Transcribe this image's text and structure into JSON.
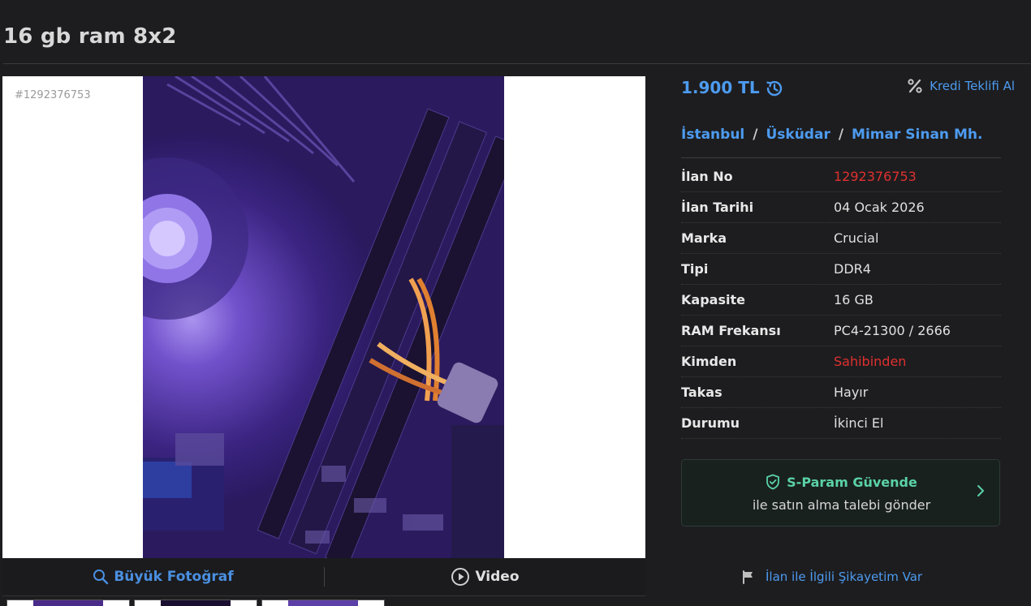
{
  "listing": {
    "title": "16 gb ram 8x2",
    "photo_id": "#1292376753"
  },
  "gallery": {
    "big_photo_label": "Büyük Fotoğraf",
    "video_label": "Video"
  },
  "price": {
    "value": "1.900 TL",
    "credit_label": "Kredi Teklifi Al"
  },
  "location": {
    "city": "İstanbul",
    "district": "Üsküdar",
    "neighborhood": "Mimar Sinan Mh.",
    "separator": "/"
  },
  "details": [
    {
      "label": "İlan No",
      "value": "1292376753",
      "highlight": true
    },
    {
      "label": "İlan Tarihi",
      "value": "04 Ocak 2026",
      "highlight": false
    },
    {
      "label": "Marka",
      "value": "Crucial",
      "highlight": false
    },
    {
      "label": "Tipi",
      "value": "DDR4",
      "highlight": false
    },
    {
      "label": "Kapasite",
      "value": "16 GB",
      "highlight": false
    },
    {
      "label": "RAM Frekansı",
      "value": "PC4-21300 / 2666",
      "highlight": false
    },
    {
      "label": "Kimden",
      "value": "Sahibinden",
      "highlight": true
    },
    {
      "label": "Takas",
      "value": "Hayır",
      "highlight": false
    },
    {
      "label": "Durumu",
      "value": "İkinci El",
      "highlight": false
    }
  ],
  "sparam": {
    "title": "S-Param Güvende",
    "subtitle": "ile satın alma talebi gönder"
  },
  "complaint": {
    "label": "İlan ile İlgili Şikayetim Var"
  },
  "colors": {
    "accent_blue": "#4d9bf0",
    "highlight_red": "#e0302f",
    "sparam_green": "#5ad2a6",
    "background": "#1d1d1f"
  }
}
